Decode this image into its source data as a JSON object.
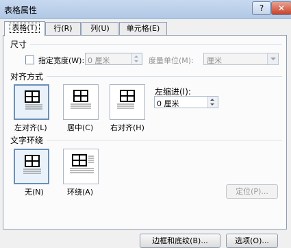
{
  "window": {
    "title": "表格属性",
    "help_label": "?",
    "close_label": "✕"
  },
  "tabs": [
    {
      "label": "表格(T)",
      "active": true
    },
    {
      "label": "行(R)",
      "active": false
    },
    {
      "label": "列(U)",
      "active": false
    },
    {
      "label": "单元格(E)",
      "active": false
    }
  ],
  "size": {
    "section_label": "尺寸",
    "specify_width_label": "指定宽度(W):",
    "specify_width_checked": false,
    "width_value": "0 厘米",
    "measure_label": "度量单位(M):",
    "measure_value": "厘米"
  },
  "alignment": {
    "section_label": "对齐方式",
    "options": [
      {
        "label": "左对齐(L)",
        "selected": true
      },
      {
        "label": "居中(C)",
        "selected": false
      },
      {
        "label": "右对齐(H)",
        "selected": false
      }
    ],
    "indent_label": "左缩进(I):",
    "indent_value": "0 厘米"
  },
  "wrapping": {
    "section_label": "文字环绕",
    "options": [
      {
        "label": "无(N)",
        "selected": true
      },
      {
        "label": "环绕(A)",
        "selected": false
      }
    ],
    "position_button": "定位(P)..."
  },
  "bottom_buttons": {
    "borders": "边框和底纹(B)...",
    "options": "选项(O)..."
  }
}
